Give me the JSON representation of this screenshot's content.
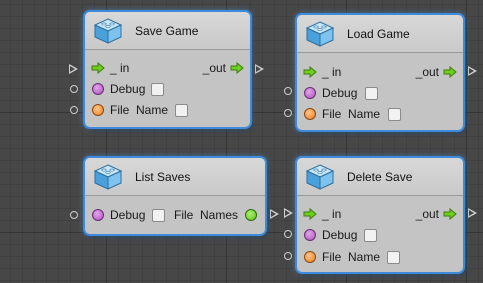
{
  "nodes": {
    "save_game": {
      "title": "Save Game",
      "flow_in": "_ in",
      "flow_out": "_out",
      "debug_label": "Debug",
      "file_name_label": "File  Name"
    },
    "load_game": {
      "title": "Load Game",
      "flow_in": "_ in",
      "flow_out": "_out",
      "debug_label": "Debug",
      "file_name_label": "File  Name"
    },
    "list_saves": {
      "title": "List Saves",
      "debug_label": "Debug",
      "file_names_label": "File  Names"
    },
    "delete_save": {
      "title": "Delete Save",
      "flow_in": "_ in",
      "flow_out": "_out",
      "debug_label": "Debug",
      "file_name_label": "File  Name"
    }
  },
  "colors": {
    "selection_glow": "#3e8bdc",
    "node_body": "#c4c4c4",
    "debug_port": "#b050c0",
    "string_port": "#f07f1e",
    "output_port": "#5cc31c",
    "flow_arrow": "#6fcf1e",
    "canvas": "#474747"
  },
  "icons": {
    "node_icon": "cube-icon",
    "flow_port": "green-arrow-icon",
    "external_flow_port": "triangle-outline-icon",
    "external_value_port": "circle-outline-icon"
  }
}
